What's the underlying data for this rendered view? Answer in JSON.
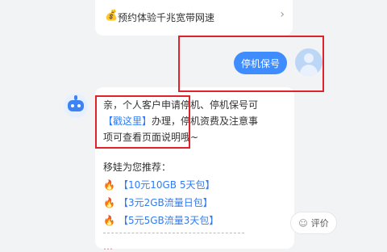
{
  "top_card": {
    "icon": "money-bag-icon",
    "text": "预约体验千兆宽带网速",
    "chevron": "›"
  },
  "user_message": {
    "text": "停机保号"
  },
  "bot_message": {
    "line1": "亲，个人客户申请停机、停机保号可",
    "link_text": "【戳这里】",
    "line2_rest": "办理，",
    "line2_tail": "停机资费及注意事",
    "line3": "项可查看页面说明哦~",
    "rec_title": "移娃为您推荐：",
    "rec_items": [
      "【10元10GB 5天包】",
      "【3元2GB流量日包】",
      "【5元5GB流量3天包】"
    ],
    "fire_icon": "🔥",
    "bottom_partial": "…"
  },
  "eval_button": {
    "label": "评价",
    "icon": "chat-icon"
  },
  "colors": {
    "accent": "#3f8cff",
    "link": "#2f7cf6",
    "annotation": "#e0222b"
  }
}
